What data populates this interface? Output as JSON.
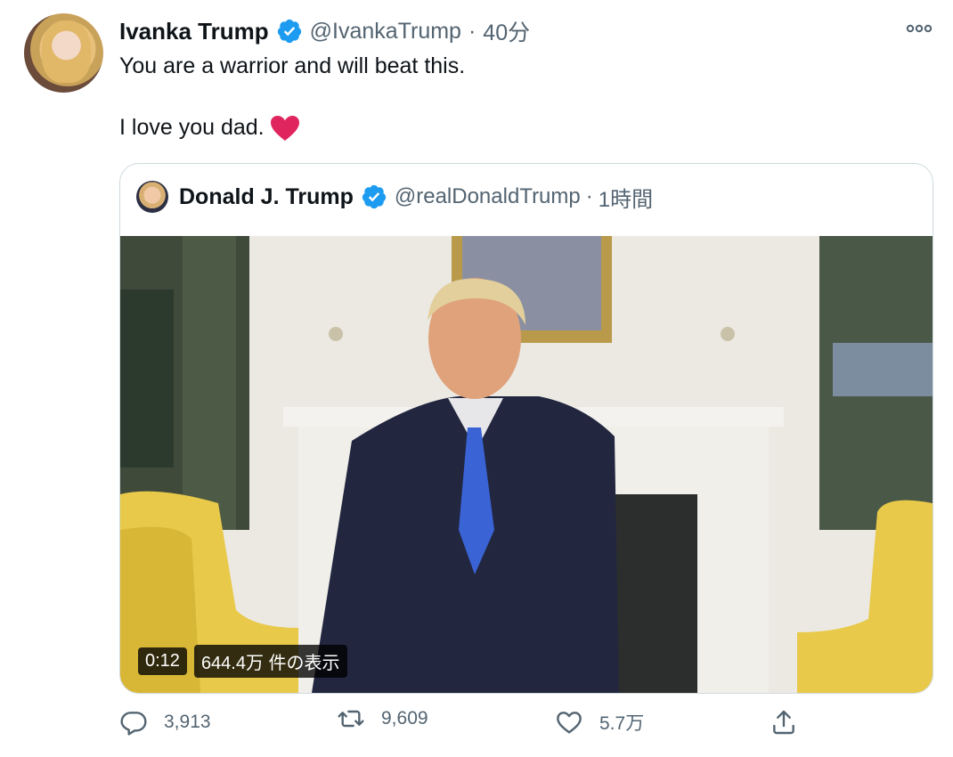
{
  "tweet": {
    "author_name": "Ivanka Trump",
    "author_handle": "@IvankaTrump",
    "separator": "·",
    "time": "40分",
    "line1": "You are a warrior and will beat this.",
    "line2": "I love you dad."
  },
  "quoted": {
    "author_name": "Donald J. Trump",
    "author_handle": "@realDonaldTrump",
    "separator": "·",
    "time": "1時間",
    "video": {
      "duration": "0:12",
      "views": "644.4万 件の表示"
    }
  },
  "actions": {
    "reply_count": "3,913",
    "retweet_count": "9,609",
    "like_count": "5.7万"
  },
  "icons": {
    "verified": "verified-badge-icon",
    "more": "more-options-icon",
    "heart_emoji": "red-heart-icon",
    "reply": "reply-icon",
    "retweet": "retweet-icon",
    "like": "like-icon",
    "share": "share-icon"
  },
  "colors": {
    "verified_blue": "#1d9bf0",
    "secondary_text": "#536471",
    "heart_red": "#e0245e"
  }
}
